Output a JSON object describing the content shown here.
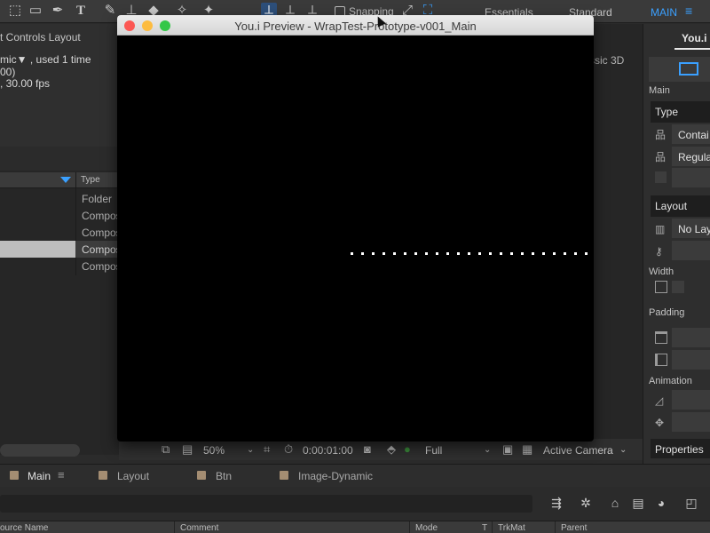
{
  "toolbar": {
    "snapping_label": "Snapping",
    "workspaces": [
      {
        "label": "Essentials",
        "active": false
      },
      {
        "label": "Standard",
        "active": false
      },
      {
        "label": "MAIN",
        "active": true
      }
    ],
    "menu_icon": "≡"
  },
  "project_panel": {
    "title": "t Controls Layout",
    "info_line1": "mic▼ , used 1 time",
    "info_line2": "00)",
    "info_line3": ", 30.00 fps",
    "type_header": "Type",
    "rows": [
      {
        "type": "Folder",
        "selected": false
      },
      {
        "type": "Compos",
        "selected": false
      },
      {
        "type": "Compos",
        "selected": false
      },
      {
        "type": "Compos",
        "selected": true
      },
      {
        "type": "Compos",
        "selected": false
      }
    ]
  },
  "preview_window": {
    "title": "You.i Preview - WrapTest-Prototype-v001_Main",
    "dot_count": 24,
    "colors": {
      "close": "#fc5753",
      "minimize": "#fdbc40",
      "zoom": "#33c748"
    }
  },
  "viewer": {
    "classic_3d": "ssic 3D",
    "zoom": "50%",
    "timecode": "0:00:01:00",
    "resolution": "Full",
    "camera": "Active Camera"
  },
  "timeline": {
    "tabs": [
      {
        "label": "Main",
        "active": true
      },
      {
        "label": "Layout",
        "active": false
      },
      {
        "label": "Btn",
        "active": false
      },
      {
        "label": "Image-Dynamic",
        "active": false
      }
    ],
    "columns": [
      "ource Name",
      "Comment",
      "Mode",
      "T",
      "TrkMat",
      "Parent"
    ]
  },
  "right_panel": {
    "tab": "You.i",
    "main_label": "Main",
    "type_section": "Type",
    "type_field1": "Contai",
    "type_field2": "Regula",
    "layout_section": "Layout",
    "layout_field": "No Lay",
    "width_label": "Width",
    "padding_label": "Padding",
    "animation_label": "Animation",
    "properties_label": "Properties"
  },
  "accent_color": "#3aa0ff"
}
